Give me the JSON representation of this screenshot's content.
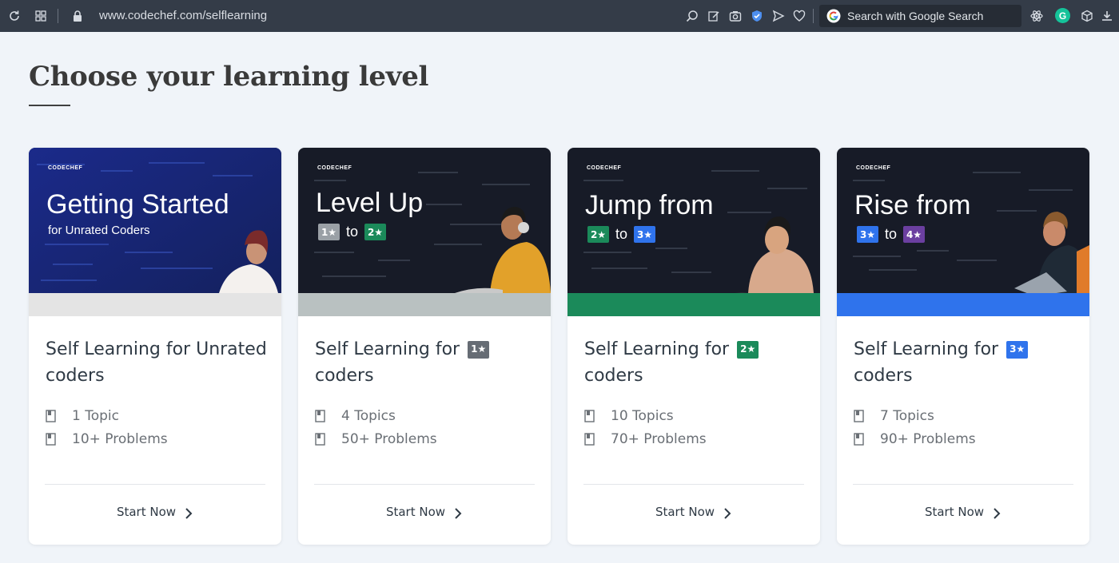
{
  "browser": {
    "url": "www.codechef.com/selflearning",
    "search_placeholder": "Search with Google Search",
    "grammarly_letter": "G"
  },
  "page": {
    "title": "Choose your learning level"
  },
  "colors": {
    "unrated_strip": "#e4e4e4",
    "one_star": "#666c74",
    "two_star": "#1b8a5a",
    "three_star": "#2f73ec",
    "four_star": "#6b3fa0"
  },
  "cards": [
    {
      "banner_brand": "CODECHEF",
      "banner_title": "Getting Started",
      "banner_subtitle": "for Unrated Coders",
      "title": "Self Learning for Unrated coders",
      "topics": "1 Topic",
      "problems": "10+ Problems",
      "cta": "Start Now"
    },
    {
      "banner_brand": "CODECHEF",
      "banner_title": "Level Up",
      "banner_from": "1★",
      "banner_to_word": "to",
      "banner_to": "2★",
      "title_prefix": "Self Learning for",
      "title_badge": "1★",
      "title_suffix": "coders",
      "topics": "4 Topics",
      "problems": "50+ Problems",
      "cta": "Start Now"
    },
    {
      "banner_brand": "CODECHEF",
      "banner_title": "Jump from",
      "banner_from": "2★",
      "banner_to_word": "to",
      "banner_to": "3★",
      "title_prefix": "Self Learning for",
      "title_badge": "2★",
      "title_suffix": "coders",
      "topics": "10 Topics",
      "problems": "70+ Problems",
      "cta": "Start Now"
    },
    {
      "banner_brand": "CODECHEF",
      "banner_title": "Rise from",
      "banner_from": "3★",
      "banner_to_word": "to",
      "banner_to": "4★",
      "title_prefix": "Self Learning for",
      "title_badge": "3★",
      "title_suffix": "coders",
      "topics": "7 Topics",
      "problems": "90+ Problems",
      "cta": "Start Now"
    }
  ]
}
